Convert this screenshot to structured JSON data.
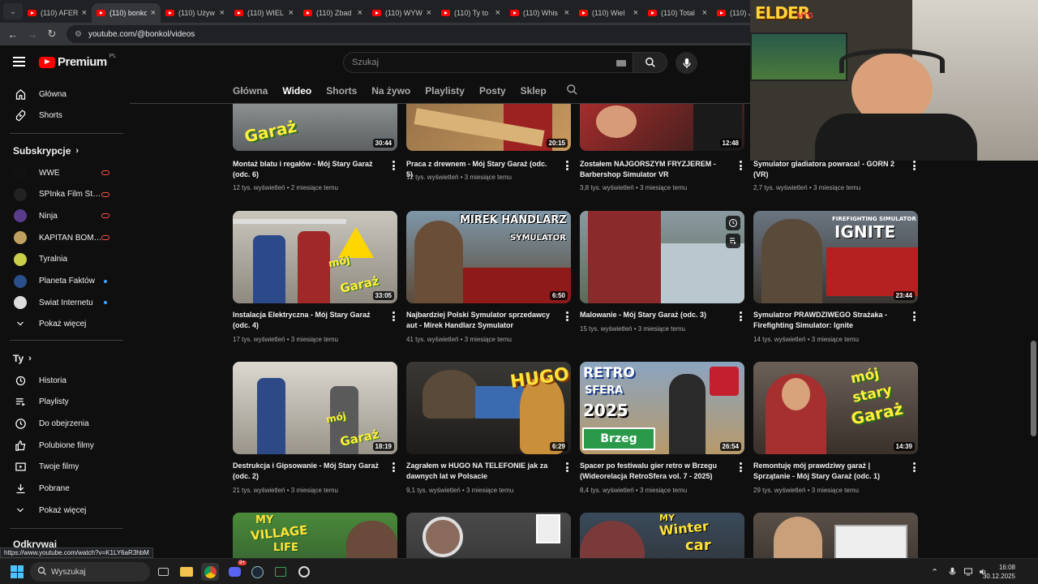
{
  "browser": {
    "tabs": [
      {
        "title": "(110) AFER",
        "active": false
      },
      {
        "title": "(110) bonkol",
        "active": true
      },
      {
        "title": "(110) Używ",
        "active": false
      },
      {
        "title": "(110) WIEL",
        "active": false
      },
      {
        "title": "(110) Zbad",
        "active": false
      },
      {
        "title": "(110) WYW",
        "active": false
      },
      {
        "title": "(110) Ty to",
        "active": false
      },
      {
        "title": "(110) Whis",
        "active": false
      },
      {
        "title": "(110) Wiel",
        "active": false
      },
      {
        "title": "(110) Total",
        "active": false
      },
      {
        "title": "(110) Ju",
        "active": false
      }
    ],
    "url": "youtube.com/@bonkol/videos",
    "status_url": "https://www.youtube.com/watch?v=K1LY6aR3hbM"
  },
  "header": {
    "logo_text": "Premium",
    "logo_region": "PL",
    "search_placeholder": "Szukaj"
  },
  "sidebar": {
    "main": [
      {
        "label": "Główna",
        "icon": "home-icon"
      },
      {
        "label": "Shorts",
        "icon": "shorts-icon"
      }
    ],
    "subs_heading": "Subskrypcje",
    "subs": [
      {
        "label": "WWE",
        "status": "live",
        "color": "#111111"
      },
      {
        "label": "SPInka Film Studio",
        "status": "live",
        "color": "#222222"
      },
      {
        "label": "Ninja",
        "status": "live",
        "color": "#5a3d8a"
      },
      {
        "label": "KAPITAN BOMBA",
        "status": "live",
        "color": "#c0a060"
      },
      {
        "label": "Tyralnia",
        "status": "none",
        "color": "#c8d04a"
      },
      {
        "label": "Planeta Faktów",
        "status": "new",
        "color": "#2a4f8a"
      },
      {
        "label": "Świat Internetu",
        "status": "new",
        "color": "#dddddd"
      }
    ],
    "subs_more": "Pokaż więcej",
    "you_heading": "Ty",
    "you": [
      {
        "label": "Historia",
        "icon": "history-icon"
      },
      {
        "label": "Playlisty",
        "icon": "playlists-icon"
      },
      {
        "label": "Do obejrzenia",
        "icon": "watch-later-icon"
      },
      {
        "label": "Polubione filmy",
        "icon": "like-icon"
      },
      {
        "label": "Twoje filmy",
        "icon": "your-videos-icon"
      },
      {
        "label": "Pobrane",
        "icon": "download-icon"
      }
    ],
    "you_more": "Pokaż więcej",
    "explore_heading": "Odkrywaj"
  },
  "channel_tabs": [
    "Główna",
    "Wideo",
    "Shorts",
    "Na żywo",
    "Playlisty",
    "Posty",
    "Sklep"
  ],
  "active_tab": "Wideo",
  "videos": [
    {
      "title": "Montaż blatu i regałów - Mój Stary Garaż (odc. 6)",
      "views": "12 tys. wyświetleń",
      "age": "2 miesiące temu",
      "duration": "30:44"
    },
    {
      "title": "Praca z drewnem - Mój Stary Garaż (odc. 5)",
      "views": "12 tys. wyświetleń",
      "age": "3 miesiące temu",
      "duration": "20:15"
    },
    {
      "title": "Zostałem NAJGORSZYM FRYZJEREM - Barbershop Simulator VR",
      "views": "3,8 tys. wyświetleń",
      "age": "3 miesiące temu",
      "duration": "12:48"
    },
    {
      "title": "Symulator gladiatora powraca! - GORN 2 (VR)",
      "views": "2,7 tys. wyświetleń",
      "age": "3 miesiące temu",
      "duration": ""
    },
    {
      "title": "Instalacja Elektryczna - Mój Stary Garaż (odc. 4)",
      "views": "17 tys. wyświetleń",
      "age": "3 miesiące temu",
      "duration": "33:05"
    },
    {
      "title": "Najbardziej Polski Symulator sprzedawcy aut - Mirek Handlarz Symulator",
      "views": "41 tys. wyświetleń",
      "age": "3 miesiące temu",
      "duration": "6:50"
    },
    {
      "title": "Malowanie - Mój Stary Garaż (odc. 3)",
      "views": "15 tys. wyświetleń",
      "age": "3 miesiące temu",
      "duration": ""
    },
    {
      "title": "Symulatror PRAWDZIWEGO Strażaka - Firefighting Simulator: Ignite",
      "views": "14 tys. wyświetleń",
      "age": "3 miesiące temu",
      "duration": "23:44"
    },
    {
      "title": "Destrukcja i Gipsowanie - Mój Stary Garaż (odc. 2)",
      "views": "21 tys. wyświetleń",
      "age": "3 miesiące temu",
      "duration": "18:19"
    },
    {
      "title": "Zagrałem w HUGO NA TELEFONIE jak za dawnych lat w Polsacie",
      "views": "9,1 tys. wyświetleń",
      "age": "3 miesiące temu",
      "duration": "6:29"
    },
    {
      "title": "Spacer po festiwalu gier retro w Brzegu (Wideorelacja RetroSfera vol. 7 - 2025)",
      "views": "8,4 tys. wyświetleń",
      "age": "3 miesiące temu",
      "duration": "26:54"
    },
    {
      "title": "Remontuję mój prawdziwy garaż | Sprzątanie - Mój Stary Garaż (odc. 1)",
      "views": "29 tys. wyświetleń",
      "age": "3 miesiące temu",
      "duration": "14:39"
    }
  ],
  "thumb_texts": {
    "moj": "mój",
    "stary": "stary",
    "garaz": "Garaż",
    "mirek": "MIREK HANDLARZ",
    "symulator": "SYMULATOR",
    "firefighting": "FIREFIGHTING SIMULATOR",
    "ignite": "IGNITE",
    "hugo": "HUGO",
    "retro": "RETRO",
    "sfera": "SFERA",
    "year": "2025",
    "brzeg": "Brzeg",
    "my": "MY",
    "village": "VILLAGE",
    "life": "LIFE",
    "winter": "Winter",
    "car": "car"
  },
  "webcam_label": "ELDER",
  "webcam_label_sup": "MTG",
  "taskbar": {
    "search": "Wyszukaj",
    "time": "16:08",
    "date": "30.12.2025",
    "discord_badge": "9+"
  }
}
